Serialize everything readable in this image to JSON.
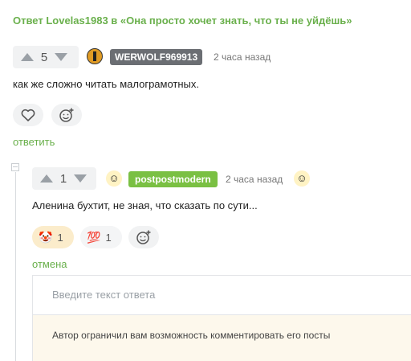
{
  "reply_header": "Ответ Lovelas1983 в «Она просто хочет знать, что ты не уйдёшь»",
  "comment1": {
    "vote_count": "5",
    "username": "WERWOLF969913",
    "timestamp": "2 часа назад",
    "text": "как же сложно читать малограмотных.",
    "reply_link": "ответить"
  },
  "comment2": {
    "vote_count": "1",
    "username": "postpostmodern",
    "timestamp": "2 часа назад",
    "text": "Аленина бухтит, не зная, что сказать по сути...",
    "reactions": [
      {
        "emoji": "🤡",
        "count": "1"
      },
      {
        "emoji": "💯",
        "count": "1"
      }
    ],
    "cancel_link": "отмена"
  },
  "reply_form": {
    "placeholder": "Введите текст ответа",
    "notice": "Автор ограничил вам возможность комментировать его посты"
  },
  "colors": {
    "accent_green": "#6ab04c",
    "user_badge_gray": "#6b6e73",
    "user_badge_green": "#7ac043"
  }
}
